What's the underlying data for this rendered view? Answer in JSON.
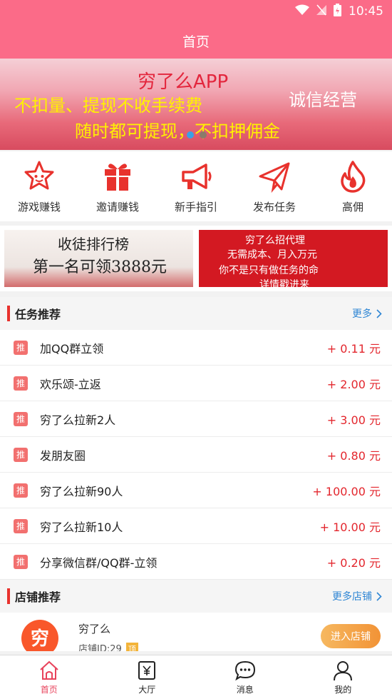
{
  "status_bar": {
    "time": "10:45"
  },
  "header": {
    "title": "首页"
  },
  "banner": {
    "title": "穷了么APP",
    "line1": "不扣量、提现不收手续费",
    "side": "诚信经营",
    "line2": "随时都可提现，不扣押佣金"
  },
  "quick_actions": [
    {
      "label": "游戏赚钱",
      "icon": "star-face-icon"
    },
    {
      "label": "邀请赚钱",
      "icon": "gift-icon"
    },
    {
      "label": "新手指引",
      "icon": "megaphone-icon"
    },
    {
      "label": "发布任务",
      "icon": "paper-plane-icon"
    },
    {
      "label": "高佣",
      "icon": "flame-icon"
    }
  ],
  "promos": {
    "left": {
      "line1": "收徒排行榜",
      "line2": "第一名可领3888元"
    },
    "right": {
      "line1": "穷了么招代理",
      "line2": "无需成本、月入万元",
      "line3": "你不是只有做任务的命",
      "line4": "详情戳进来"
    }
  },
  "tasks_section": {
    "title": "任务推荐",
    "more": "更多"
  },
  "tasks": [
    {
      "tag": "推",
      "name": "加QQ群立领",
      "reward": "+ 0.11 元"
    },
    {
      "tag": "推",
      "name": "欢乐颂-立返",
      "reward": "+ 2.00 元"
    },
    {
      "tag": "推",
      "name": "穷了么拉新2人",
      "reward": "+ 3.00 元"
    },
    {
      "tag": "推",
      "name": "发朋友圈",
      "reward": "+ 0.80 元"
    },
    {
      "tag": "推",
      "name": "穷了么拉新90人",
      "reward": "+ 100.00 元"
    },
    {
      "tag": "推",
      "name": "穷了么拉新10人",
      "reward": "+ 10.00 元"
    },
    {
      "tag": "推",
      "name": "分享微信群/QQ群-立领",
      "reward": "+ 0.20 元"
    }
  ],
  "stores_section": {
    "title": "店铺推荐",
    "more": "更多店铺"
  },
  "store": {
    "logo_text": "穷",
    "name": "穷了么",
    "id_text": "店铺ID:29",
    "badge": "顶",
    "enter_label": "进入店铺"
  },
  "bottom_nav": [
    {
      "label": "首页",
      "icon": "home-icon",
      "active": true
    },
    {
      "label": "大厅",
      "icon": "hall-icon",
      "active": false
    },
    {
      "label": "消息",
      "icon": "message-icon",
      "active": false
    },
    {
      "label": "我的",
      "icon": "user-icon",
      "active": false
    }
  ],
  "colors": {
    "brand": "#fb6b88",
    "accent_red": "#e3262d",
    "link_blue": "#2f86d4"
  }
}
